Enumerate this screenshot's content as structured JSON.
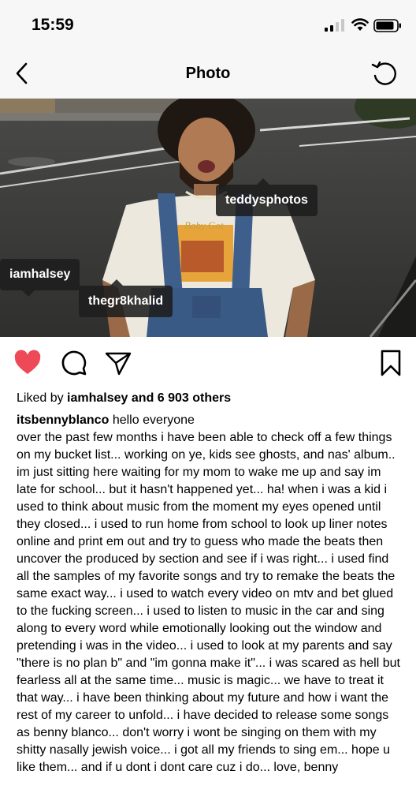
{
  "status": {
    "time": "15:59"
  },
  "nav": {
    "title": "Photo"
  },
  "photo": {
    "tags": [
      "teddysphotos",
      "iamhalsey",
      "thegr8khalid"
    ],
    "shirt_text": "Baby Got"
  },
  "likes": {
    "prefix": "Liked by",
    "user": "iamhalsey",
    "suffix": "and 6 903 others"
  },
  "caption": {
    "user": "itsbennyblanco",
    "first_line": "hello everyone",
    "body": "over the past few months i have been able to check off a few things on my bucket list... working on ye, kids see ghosts, and nas' album.. im just sitting here waiting for my mom to wake me up and say im late for school... but it hasn't happened yet... ha! when i was a kid i used to think about music from the moment my eyes opened until they closed... i used to run home from school to look up liner notes online and print em out and try to guess who made the beats then uncover the produced by section and see if i was right... i used find all the samples of my favorite songs and try to remake the beats the same exact way... i used to watch every video on mtv and bet glued to the fucking screen... i used to listen to music in the car and sing along to every word while emotionally looking out the window and pretending i was in the video... i used to look at my parents and say \"there is no plan b\" and \"im gonna make it\"... i was scared as hell but fearless all at the same time... music is magic... we have to treat it that way... i have been thinking about my future and how i want the rest of my career to unfold... i have decided to release some songs as benny blanco... don't worry i wont be singing on them with my shitty nasally jewish voice... i got all my friends to sing em... hope u like them... and if u dont i dont care cuz i do... love, benny"
  },
  "colors": {
    "like_red": "#ed4956",
    "tag_bg": "#1e1e1e"
  }
}
